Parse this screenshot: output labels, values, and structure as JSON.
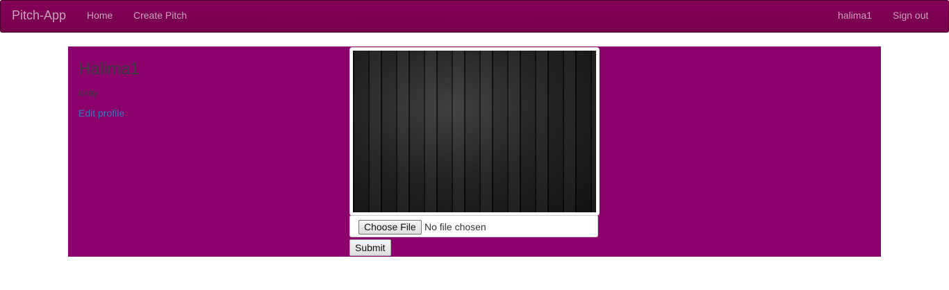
{
  "navbar": {
    "brand": "Pitch-App",
    "links": [
      "Home",
      "Create Pitch"
    ],
    "user": "halima1",
    "signout": "Sign out"
  },
  "profile": {
    "name": "Halima1",
    "bio": "okay",
    "edit_label": "Edit profile"
  },
  "upload": {
    "choose_label": "Choose File",
    "status": "No file chosen",
    "submit_label": "Submit"
  },
  "colors": {
    "navbar": "#7d0052",
    "panel": "#8c006b",
    "link": "#337ab7"
  }
}
